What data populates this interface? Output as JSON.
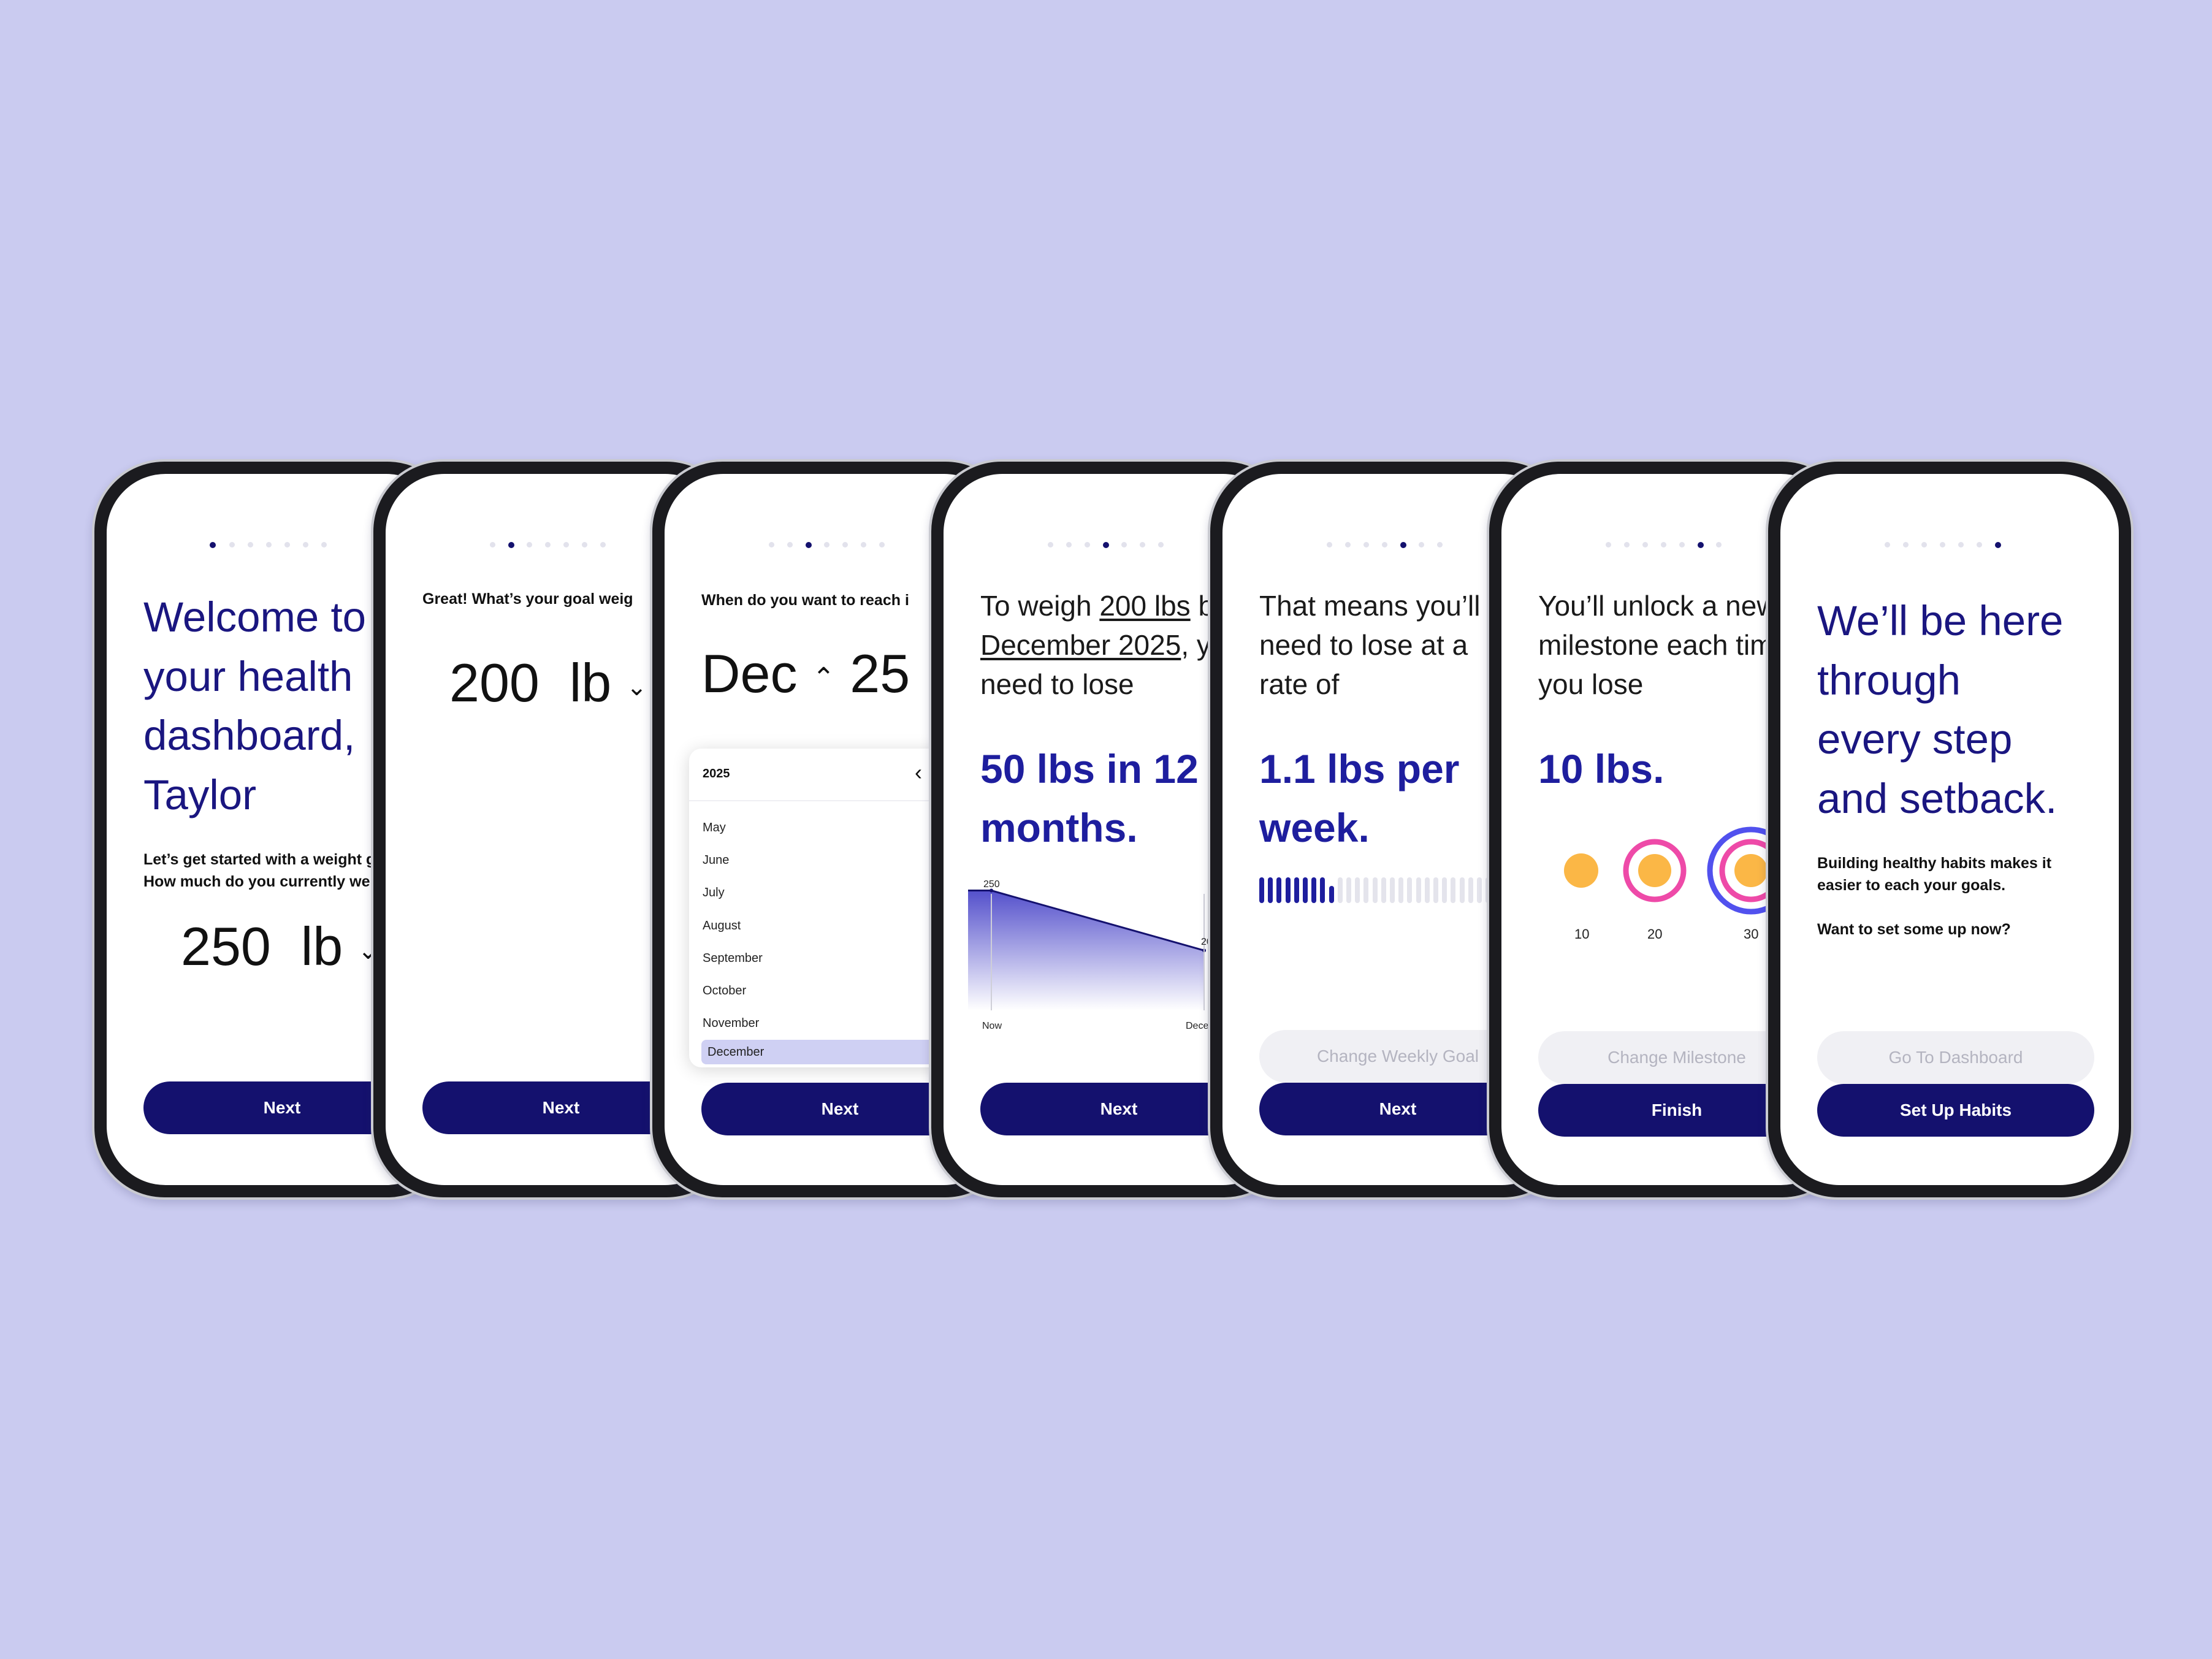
{
  "colors": {
    "background": "#cacbf0",
    "primary": "#14116e",
    "accent_text": "#1e1e9e",
    "orange": "#fbb746",
    "pink": "#ee4aa8",
    "blue_ring": "#5151ee"
  },
  "s1": {
    "title_lines": [
      "Welcome to",
      "your health",
      "dashboard,",
      "Taylor"
    ],
    "sub_lines": [
      "Let’s get started with a weight g",
      "How much do you currently wei"
    ],
    "weight": "250",
    "unit": "lb",
    "next": "Next"
  },
  "s2": {
    "question": "Great! What’s your goal weig",
    "weight": "200",
    "unit": "lb",
    "next": "Next"
  },
  "s3": {
    "question": "When do you want to reach i",
    "month": "Dec",
    "year": "25",
    "picker_year": "2025",
    "months": [
      "May",
      "June",
      "July",
      "August",
      "September",
      "October",
      "November",
      "December"
    ],
    "next": "Next"
  },
  "s4": {
    "line1_pre": "To weigh ",
    "line1_u": "200 lbs",
    "line1_post": " b",
    "line2_u": "December 2025",
    "line2_post": ", y",
    "line3": "need to lose",
    "big_lines": [
      "50 lbs in 12",
      "months."
    ],
    "chart_start_label": "250",
    "chart_end_label": "20",
    "x_start": "Now",
    "x_end": "Decem",
    "next": "Next"
  },
  "s5": {
    "lines": [
      "That means you’ll",
      "need to lose at a",
      "rate of"
    ],
    "big_lines": [
      "1.1 lbs per",
      "week."
    ],
    "progress_filled": 9,
    "progress_total": 32,
    "secondary": "Change Weekly Goal",
    "next": "Next"
  },
  "s6": {
    "lines": [
      "You’ll unlock a new",
      "milestone each tim",
      "you lose"
    ],
    "big": "10 lbs.",
    "milestone_labels": [
      "10",
      "20",
      "30"
    ],
    "secondary": "Change Milestone",
    "finish": "Finish"
  },
  "s7": {
    "title_lines": [
      "We’ll be here",
      "through",
      "every step",
      "and setback."
    ],
    "sub_lines": [
      "Building healthy habits makes it",
      "easier to each your goals."
    ],
    "question": "Want to set some up now?",
    "secondary": "Go To Dashboard",
    "primary": "Set Up Habits"
  },
  "chart_data": {
    "type": "area",
    "x": [
      "Now",
      "December"
    ],
    "values": [
      250,
      200
    ]
  }
}
